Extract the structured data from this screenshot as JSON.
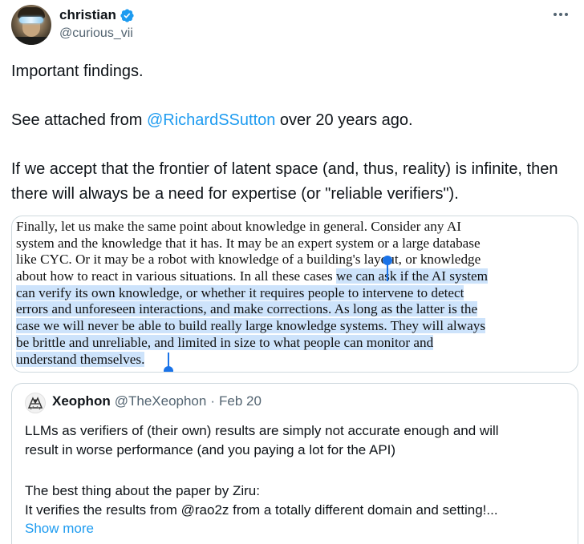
{
  "author": {
    "display_name": "christian",
    "handle": "@curious_vii",
    "verified": true
  },
  "icons": {
    "verified": "verified-badge-icon",
    "more": "more-options-icon"
  },
  "tweet": {
    "line1": "Important findings.",
    "line2_prefix": "See attached from ",
    "line2_mention": "@RichardSSutton",
    "line2_suffix": " over 20 years ago.",
    "line3": "If we accept that the frontier of latent space (and, thus, reality) is infinite, then there will always be a need for expertise (or \"reliable verifiers\")."
  },
  "attached_text": {
    "lines": [
      "Finally, let us make the same point about knowledge in general. Consider any AI",
      "system and the knowledge that it has. It may be an expert system or a large database",
      "like CYC. Or it may be a robot with knowledge of a building's layout, or knowledge"
    ],
    "line4_unselected": "about how to react in various situations. In all these cases ",
    "line4_selected": "we can ask if the AI system",
    "selected_lines": [
      "can verify its own knowledge, or whether it requires people to intervene to detect",
      "errors and unforeseen interactions, and make corrections. As long as the latter is the",
      "case we will never be able to build really large knowledge systems. They will always",
      "be brittle and unreliable, and limited in size to what people can monitor and",
      "understand themselves."
    ]
  },
  "quoted_tweet": {
    "display_name": "Xeophon",
    "handle": "@TheXeophon",
    "separator": "·",
    "date": "Feb 20",
    "line1": "LLMs as verifiers of (their own) results are simply not accurate enough and will",
    "line2": "result in worse performance (and you paying a lot for the API)",
    "line3": "The best thing about the paper by Ziru:",
    "line4": "It verifies the results from @rao2z from a totally different domain and setting!...",
    "show_more": "Show more"
  },
  "colors": {
    "link": "#1d9bf0",
    "secondary_text": "#536471",
    "selection": "#cde3fb",
    "selection_handle": "#1a73e8"
  }
}
